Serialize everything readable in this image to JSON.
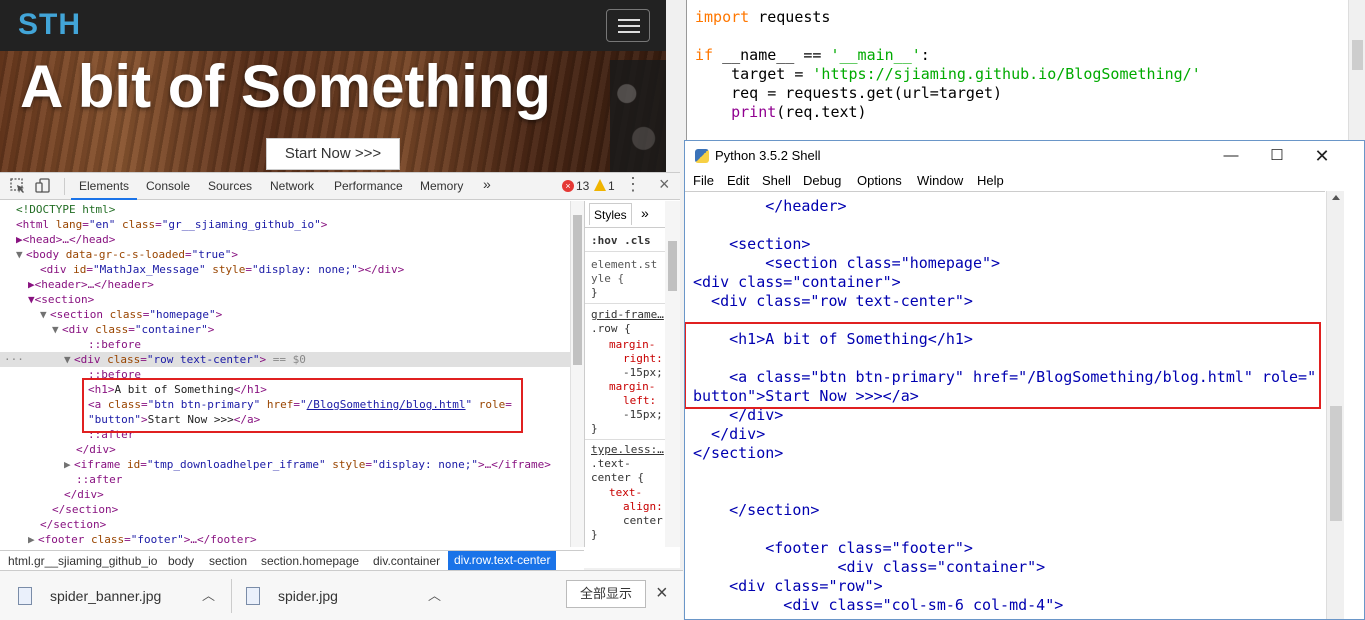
{
  "site": {
    "brand": "STH",
    "headline": "A bit of Something",
    "cta": "Start Now >>>"
  },
  "devtools": {
    "tabs": [
      "Elements",
      "Console",
      "Sources",
      "Network",
      "Performance",
      "Memory"
    ],
    "more": "»",
    "error_count": "13",
    "warning_count": "1",
    "close": "×",
    "dom": [
      "<!DOCTYPE html>",
      "<html lang=\"en\" class=\"gr__sjiaming_github_io\">",
      "▶<head>…</head>",
      "▼<body data-gr-c-s-loaded=\"true\">",
      "<div id=\"MathJax_Message\" style=\"display: none;\"></div>",
      "▶<header>…</header>",
      "▼<section>",
      "▼<section class=\"homepage\">",
      "▼<div class=\"container\">",
      "::before",
      "▼<div class=\"row text-center\"> == $0",
      "::before",
      "<h1>A bit of Something</h1>",
      "<a class=\"btn btn-primary\" href=\"/BlogSomething/blog.html\" role=",
      "\"button\">Start Now >>></a>",
      "::after",
      "</div>",
      "▶<iframe id=\"tmp_downloadhelper_iframe\" style=\"display: none;\">…</iframe>",
      "::after",
      "</div>",
      "</section>",
      "</section>",
      "▶<footer class=\"footer\">…</footer>"
    ],
    "styles_tab": "Styles",
    "styles_more": "»",
    "styles": [
      ":hov .cls",
      "element.st",
      "yle {",
      "}",
      "grid-frame…",
      ".row {",
      "margin-",
      "right:",
      "-15px;",
      "margin-",
      "left:",
      "-15px;",
      "}",
      "type.less:…",
      ".text-",
      "center {",
      "text-",
      "align:",
      "center",
      "}"
    ],
    "breadcrumbs": [
      "html.gr__sjiaming_github_io",
      "body",
      "section",
      "section.homepage",
      "div.container",
      "div.row.text-center"
    ]
  },
  "downloads": {
    "items": [
      "spider_banner.jpg",
      "spider.jpg"
    ],
    "show_all": "全部显示",
    "close": "×"
  },
  "editor": {
    "lines": [
      "import requests",
      "",
      "if __name__ == '__main__':",
      "    target = 'https://sjiaming.github.io/BlogSomething/'",
      "    req = requests.get(url=target)",
      "    print(req.text)"
    ]
  },
  "shell": {
    "title": "Python 3.5.2 Shell",
    "menu": [
      "File",
      "Edit",
      "Shell",
      "Debug",
      "Options",
      "Window",
      "Help"
    ],
    "lines": [
      "        </header>",
      "",
      "    <section>",
      "        <section class=\"homepage\">",
      "<div class=\"container\">",
      "  <div class=\"row text-center\">",
      "",
      "    <h1>A bit of Something</h1>",
      "",
      "    <a class=\"btn btn-primary\" href=\"/BlogSomething/blog.html\" role=\"",
      "button\">Start Now >>></a>",
      "    </div>",
      "  </div>",
      "</section>",
      "",
      "",
      "    </section>",
      "",
      "        <footer class=\"footer\">",
      "                <div class=\"container\">",
      "    <div class=\"row\">",
      "          <div class=\"col-sm-6 col-md-4\">"
    ]
  },
  "colors": {
    "accent": "#1a73e8",
    "annotation_red": "#e02020",
    "brand": "#42a5d8"
  }
}
